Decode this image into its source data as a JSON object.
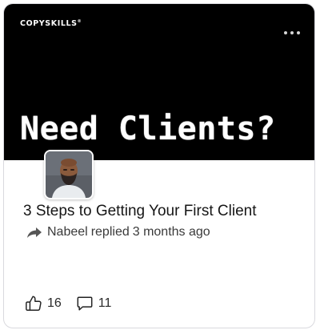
{
  "card": {
    "banner": {
      "brand": "COPYSKILLS",
      "brand_mark": "®",
      "headline": "Need Clients?",
      "background_color": "#000000"
    },
    "menu_icon": "more-horizontal-icon",
    "avatar_icon": "author-avatar",
    "title": "3 Steps to Getting Your First Client",
    "meta": {
      "reply_icon": "reply-arrow-icon",
      "author": "Nabeel",
      "action": "replied",
      "time": "3 months ago"
    },
    "footer": {
      "likes_icon": "thumbs-up-icon",
      "likes_count": "16",
      "comments_icon": "comment-icon",
      "comments_count": "11"
    }
  }
}
